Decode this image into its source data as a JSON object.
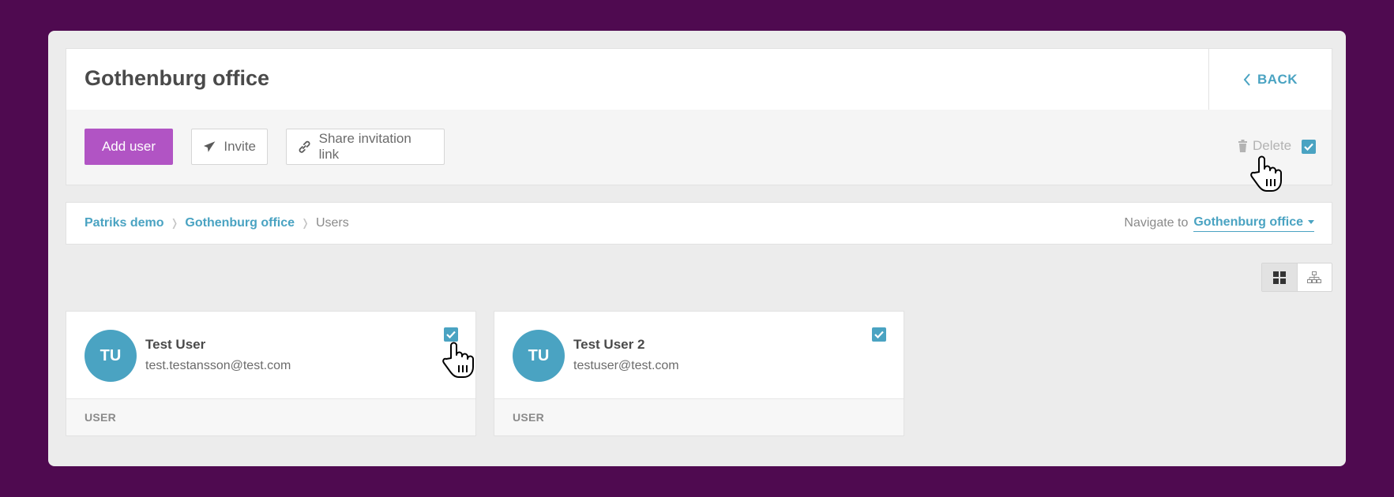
{
  "header": {
    "title": "Gothenburg office",
    "back_label": "BACK"
  },
  "toolbar": {
    "add_user_label": "Add user",
    "invite_label": "Invite",
    "share_label": "Share invitation link",
    "delete_label": "Delete"
  },
  "breadcrumb": {
    "items": [
      "Patriks demo",
      "Gothenburg office",
      "Users"
    ],
    "navigate_label": "Navigate to",
    "navigate_value": "Gothenburg office"
  },
  "users": [
    {
      "initials": "TU",
      "name": "Test User",
      "email": "test.testansson@test.com",
      "role": "USER",
      "checked": true
    },
    {
      "initials": "TU",
      "name": "Test User 2",
      "email": "testuser@test.com",
      "role": "USER",
      "checked": true
    }
  ],
  "colors": {
    "accent": "#4aa3c2",
    "primary_button": "#b154c4",
    "background": "#4f0a50"
  },
  "icons": [
    "chevron-left-icon",
    "paper-plane-icon",
    "link-icon",
    "trash-icon",
    "check-icon",
    "grid-view-icon",
    "tree-view-icon",
    "hand-cursor-icon"
  ]
}
